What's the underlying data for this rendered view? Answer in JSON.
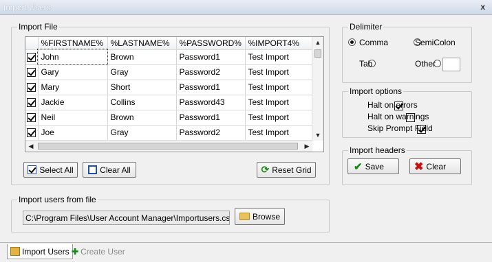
{
  "window": {
    "title": "Import Users",
    "close": "x"
  },
  "import_file": {
    "legend": "Import File",
    "columns": [
      "%FIRSTNAME%",
      "%LASTNAME%",
      "%PASSWORD%",
      "%IMPORT4%"
    ],
    "rows": [
      {
        "checked": true,
        "cells": [
          "John",
          "Brown",
          "Password1",
          "Test Import"
        ]
      },
      {
        "checked": true,
        "cells": [
          "Gary",
          "Gray",
          "Password2",
          "Test Import"
        ]
      },
      {
        "checked": true,
        "cells": [
          "Mary",
          "Short",
          "Password1",
          "Test Import"
        ]
      },
      {
        "checked": true,
        "cells": [
          "Jackie",
          "Collins",
          "Password43",
          "Test Import"
        ]
      },
      {
        "checked": true,
        "cells": [
          "Neil",
          "Brown",
          "Password1",
          "Test Import"
        ]
      },
      {
        "checked": true,
        "cells": [
          "Joe",
          "Gray",
          "Password2",
          "Test Import"
        ]
      }
    ],
    "select_all": "Select All",
    "clear_all": "Clear All",
    "reset_grid": "Reset Grid"
  },
  "import_from_file": {
    "legend": "Import users from file",
    "path": "C:\\Program Files\\User Account Manager\\Importusers.csv",
    "browse": "Browse"
  },
  "delimiter": {
    "legend": "Delimiter",
    "options": [
      "Comma",
      "SemiColon",
      "Tab",
      "Other"
    ],
    "selected": "Comma",
    "other_value": ""
  },
  "import_options": {
    "legend": "Import options",
    "items": [
      {
        "label": "Halt on errors",
        "checked": true
      },
      {
        "label": "Halt on warnings",
        "checked": false
      },
      {
        "label": "Skip Prompt Field",
        "checked": true
      }
    ]
  },
  "import_headers": {
    "legend": "Import headers",
    "save": "Save",
    "clear": "Clear"
  },
  "tabs": [
    {
      "label": "Import Users",
      "active": true
    },
    {
      "label": "Create User",
      "active": false
    }
  ],
  "colors": {
    "accent_blue": "#1f4fa0",
    "save_green": "#1a8a1a",
    "clear_red": "#cc1010"
  }
}
